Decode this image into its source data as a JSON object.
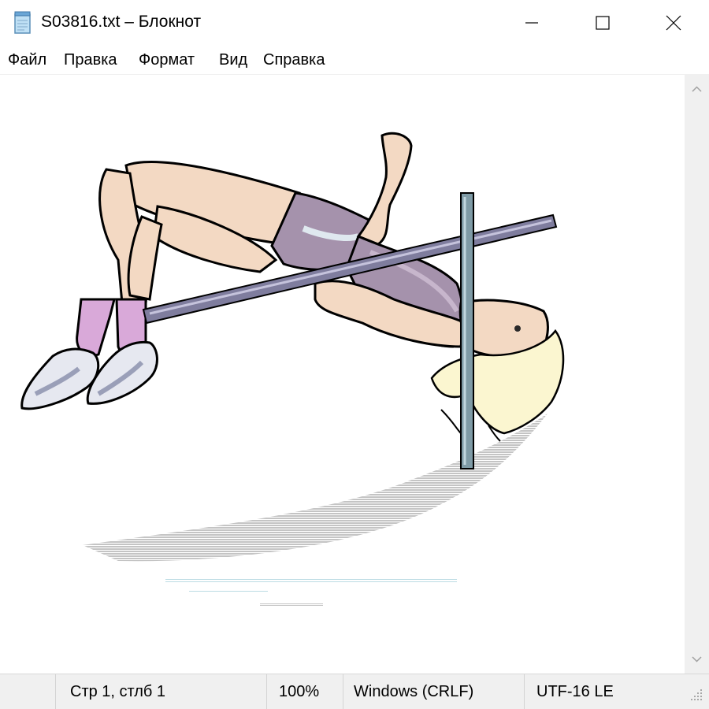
{
  "window": {
    "title": "S03816.txt – Блокнот",
    "controls": {
      "minimize": "minimize-icon",
      "maximize": "maximize-icon",
      "close": "close-icon"
    }
  },
  "menu": {
    "items": [
      "Файл",
      "Правка",
      "Формат",
      "Вид",
      "Справка"
    ]
  },
  "status": {
    "position": "Стр 1, стлб 1",
    "zoom": "100%",
    "line_endings": "Windows (CRLF)",
    "encoding": "UTF-16 LE"
  },
  "colors": {
    "chrome": "#f0f0f0",
    "skin": "#f3d9c3",
    "leotard": "#a592ac",
    "socks": "#d9a9d9",
    "hair": "#fbf6d0",
    "bar": "#7f7d9e",
    "post": "#7f9ba6",
    "shadow": "#c8c8c8"
  }
}
